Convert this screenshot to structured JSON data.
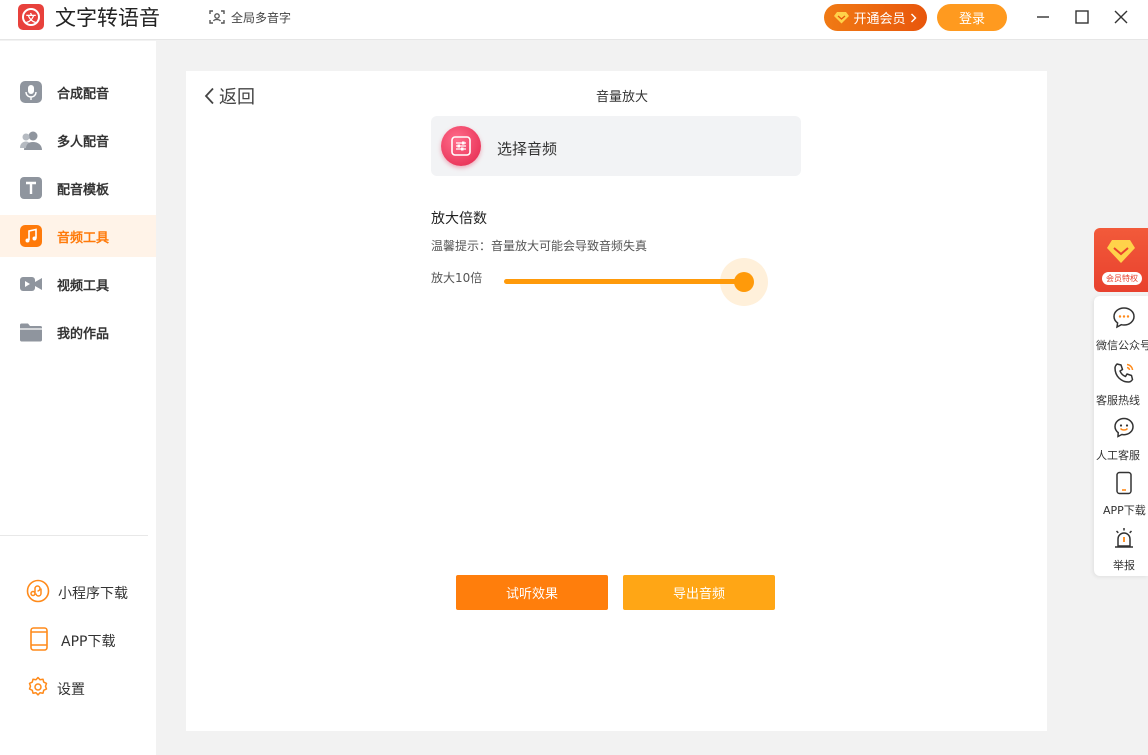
{
  "titlebar": {
    "app_title": "文字转语音",
    "app_logo_char": "文",
    "global_polyphone": "全局多音字",
    "vip_button": "开通会员",
    "login_button": "登录"
  },
  "sidebar": {
    "items": [
      {
        "label": "合成配音",
        "icon": "microphone-icon"
      },
      {
        "label": "多人配音",
        "icon": "people-icon"
      },
      {
        "label": "配音模板",
        "icon": "template-t-icon"
      },
      {
        "label": "音频工具",
        "icon": "music-note-icon",
        "active": true
      },
      {
        "label": "视频工具",
        "icon": "video-camera-icon"
      },
      {
        "label": "我的作品",
        "icon": "folder-icon"
      }
    ],
    "footer": [
      {
        "label": "小程序下载",
        "icon": "mini-program-icon"
      },
      {
        "label": "APP下载",
        "icon": "phone-icon"
      },
      {
        "label": "设置",
        "icon": "gear-icon"
      }
    ]
  },
  "main": {
    "back_label": "返回",
    "page_title": "音量放大",
    "choose_audio_label": "选择音频",
    "amplify_title": "放大倍数",
    "amplify_hint": "温馨提示：音量放大可能会导致音频失真",
    "amplify_value_label": "放大10倍",
    "slider_level": 1.0,
    "preview_button": "试听效果",
    "export_button": "导出音频"
  },
  "float_panel": {
    "vip_tag": "会员特权",
    "items": [
      {
        "label": "微信公众号",
        "icon": "chat-bubble-icon"
      },
      {
        "label": "客服热线",
        "icon": "phone-call-icon"
      },
      {
        "label": "人工客服",
        "icon": "smile-bubble-icon"
      },
      {
        "label": "APP下载",
        "icon": "mobile-icon"
      },
      {
        "label": "举报",
        "icon": "alarm-icon"
      }
    ]
  },
  "colors": {
    "accent": "#ff7a0a",
    "accent_light": "#ff9a0a",
    "vip_red": "#e8412e",
    "sidebar_active_bg": "#fff3e8"
  }
}
